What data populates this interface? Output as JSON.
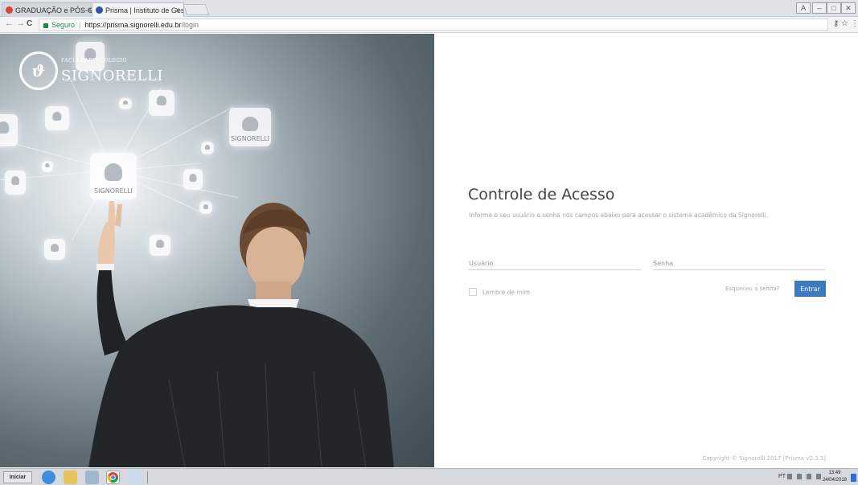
{
  "browser": {
    "tabs": [
      {
        "label": "GRADUAÇÃO e PÓS-GRAD",
        "close": "x",
        "favicon_color": "#d9443d",
        "active": false
      },
      {
        "label": "Prisma | Instituto de Gestã",
        "close": "x",
        "favicon_color": "#2e5a99",
        "active": true
      }
    ],
    "window_controls": [
      "A",
      "–",
      "□",
      "✕"
    ],
    "nav": {
      "back": "←",
      "forward": "→",
      "reload": "C"
    },
    "address": {
      "secure_label": "Seguro",
      "separator": "|",
      "host": "https://prisma.signorelli.edu.br",
      "path": "/login"
    },
    "address_icons": {
      "key": "⚷",
      "star": "☆",
      "menu": "⋮"
    }
  },
  "hero": {
    "logo_emblem": "ϑ",
    "logo_top": "FACULDADE•COLÉGIO",
    "logo_name": "SIGNORELLI",
    "node_label": "SIGNORELLI"
  },
  "login": {
    "title": "Controle de Acesso",
    "subtitle": "Informe o seu usuário e senha nos campos abaixo para acessar o sistema acadêmico da Signorelli.",
    "username_placeholder": "Usuário",
    "password_placeholder": "Senha",
    "remember_label": "Lembre de mim",
    "forgot_label": "Esqueceu a senha?",
    "submit_label": "Entrar",
    "copyright": "Copyright © Signorelli 2017 [Prisma v2.3.3]"
  },
  "taskbar": {
    "start_label": "Iniciar",
    "language": "PT",
    "time": "13:49",
    "date": "24/04/2018"
  },
  "colors": {
    "accent": "#3c7bbf",
    "secure": "#1b8a3c"
  }
}
